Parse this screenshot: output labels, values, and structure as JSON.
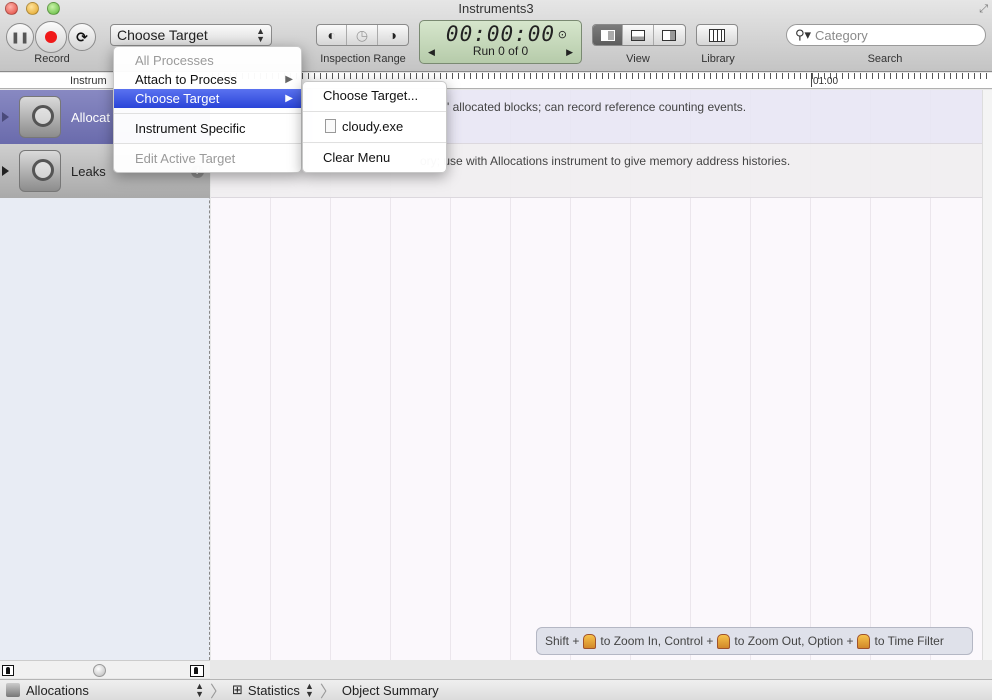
{
  "window": {
    "title": "Instruments3"
  },
  "toolbar": {
    "record_label": "Record",
    "target_select": "Choose Target",
    "inspection_range_label": "Inspection Range",
    "timer": {
      "time": "00:00:00",
      "run": "Run 0 of 0"
    },
    "view_label": "View",
    "library_label": "Library",
    "search_placeholder": "Category",
    "search_label": "Search"
  },
  "ruler": {
    "header": "Instrum",
    "tick_label": "01:00"
  },
  "instruments": [
    {
      "name": "Allocat",
      "description": "' allocated blocks; can record reference counting events.",
      "selected": true
    },
    {
      "name": "Leaks",
      "description": "ory; use with Allocations instrument to give memory address histories.",
      "selected": false
    }
  ],
  "target_menu": {
    "items": [
      {
        "label": "All Processes",
        "disabled": true
      },
      {
        "label": "Attach to Process",
        "submenu": true
      },
      {
        "label": "Choose Target",
        "submenu": true,
        "highlighted": true
      },
      {
        "label": "Instrument Specific"
      },
      {
        "label": "Edit Active Target",
        "disabled": true
      }
    ]
  },
  "choose_target_submenu": {
    "items": [
      {
        "label": "Choose Target..."
      },
      {
        "label": "cloudy.exe",
        "icon": "document-icon"
      },
      {
        "label": "Clear Menu"
      }
    ]
  },
  "hint": {
    "part1": "Shift +",
    "part2": "to Zoom In, Control +",
    "part3": "to Zoom Out, Option +",
    "part4": "to Time Filter"
  },
  "statusbar": {
    "instrument": "Allocations",
    "view_mode": "Statistics",
    "detail": "Object Summary"
  }
}
